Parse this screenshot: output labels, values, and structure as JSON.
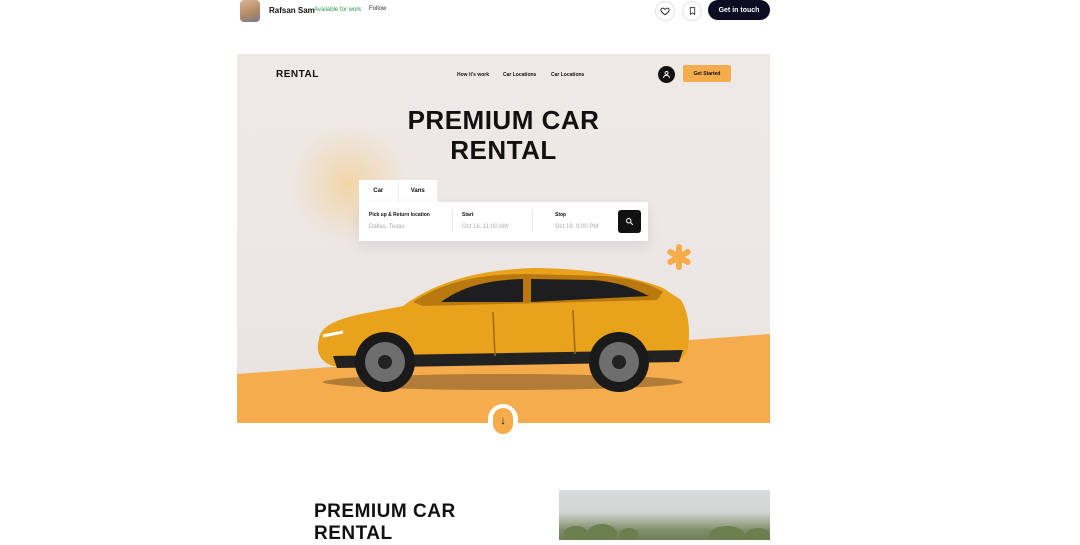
{
  "topbar": {
    "author_name": "Rafsan Sam",
    "availability": "Available for work",
    "follow_label": "Follow",
    "cta_label": "Get in touch"
  },
  "hero": {
    "logo": "RENTAL",
    "nav": [
      "How it's work",
      "Car Locations",
      "Car Locations"
    ],
    "cta_label": "Get Started",
    "title_line1": "PREMIUM CAR",
    "title_line2": "RENTAL",
    "tabs": [
      "Car",
      "Vans"
    ],
    "search": {
      "fields": [
        {
          "label": "Pick up & Return location",
          "value": "Dallas, Texas"
        },
        {
          "label": "Start",
          "value": "Oct 16, 11:00 AM"
        },
        {
          "label": "Stop",
          "value": "Oct 18, 9:00 PM"
        }
      ]
    }
  },
  "section2": {
    "title_line1": "PREMIUM CAR",
    "title_line2": "RENTAL"
  },
  "colors": {
    "accent": "#f4ac4d",
    "dark": "#0d0c22",
    "car_body": "#e8a21c"
  }
}
